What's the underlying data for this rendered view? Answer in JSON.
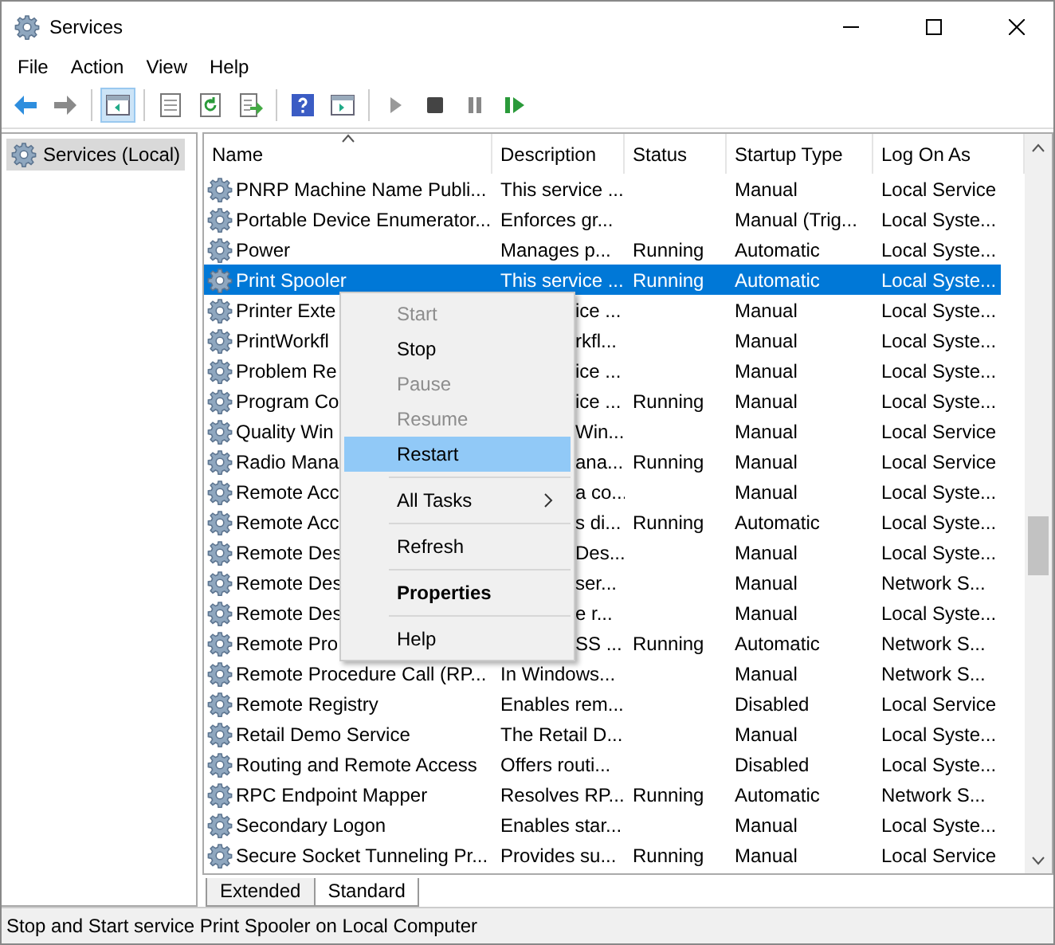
{
  "window": {
    "title": "Services"
  },
  "menu_bar": [
    "File",
    "Action",
    "View",
    "Help"
  ],
  "tree": {
    "items": [
      {
        "label": "Services (Local)",
        "selected": true
      }
    ]
  },
  "table": {
    "columns": [
      "Name",
      "Description",
      "Status",
      "Startup Type",
      "Log On As"
    ],
    "rows": [
      {
        "name": "PNRP Machine Name Publi...",
        "description": "This service ...",
        "status": "",
        "startup": "Manual",
        "logon": "Local Service",
        "selected": false,
        "partial": false
      },
      {
        "name": "Portable Device Enumerator...",
        "description": "Enforces gr...",
        "status": "",
        "startup": "Manual (Trig...",
        "logon": "Local Syste...",
        "selected": false,
        "partial": false
      },
      {
        "name": "Power",
        "description": "Manages p...",
        "status": "Running",
        "startup": "Automatic",
        "logon": "Local Syste...",
        "selected": false,
        "partial": false
      },
      {
        "name": "Print Spooler",
        "description": "This service ...",
        "status": "Running",
        "startup": "Automatic",
        "logon": "Local Syste...",
        "selected": true,
        "partial": false
      },
      {
        "name": "Printer Exte",
        "description": "ice ...",
        "status": "",
        "startup": "Manual",
        "logon": "Local Syste...",
        "selected": false,
        "partial": true
      },
      {
        "name": "PrintWorkfl",
        "description": "rkfl...",
        "status": "",
        "startup": "Manual",
        "logon": "Local Syste...",
        "selected": false,
        "partial": true
      },
      {
        "name": "Problem Re",
        "description": "ice ...",
        "status": "",
        "startup": "Manual",
        "logon": "Local Syste...",
        "selected": false,
        "partial": true
      },
      {
        "name": "Program Co",
        "description": "ice ...",
        "status": "Running",
        "startup": "Manual",
        "logon": "Local Syste...",
        "selected": false,
        "partial": true
      },
      {
        "name": "Quality Win",
        "description": "Win...",
        "status": "",
        "startup": "Manual",
        "logon": "Local Service",
        "selected": false,
        "partial": true
      },
      {
        "name": "Radio Mana",
        "description": "ana...",
        "status": "Running",
        "startup": "Manual",
        "logon": "Local Service",
        "selected": false,
        "partial": true
      },
      {
        "name": "Remote Acc",
        "description": "a co...",
        "status": "",
        "startup": "Manual",
        "logon": "Local Syste...",
        "selected": false,
        "partial": true
      },
      {
        "name": "Remote Acc",
        "description": "s di...",
        "status": "Running",
        "startup": "Automatic",
        "logon": "Local Syste...",
        "selected": false,
        "partial": true
      },
      {
        "name": "Remote Des",
        "description": "Des...",
        "status": "",
        "startup": "Manual",
        "logon": "Local Syste...",
        "selected": false,
        "partial": true
      },
      {
        "name": "Remote Des",
        "description": "ser...",
        "status": "",
        "startup": "Manual",
        "logon": "Network S...",
        "selected": false,
        "partial": true
      },
      {
        "name": "Remote Des",
        "description": "e r...",
        "status": "",
        "startup": "Manual",
        "logon": "Local Syste...",
        "selected": false,
        "partial": true
      },
      {
        "name": "Remote Pro",
        "description": "SS ...",
        "status": "Running",
        "startup": "Automatic",
        "logon": "Network S...",
        "selected": false,
        "partial": true
      },
      {
        "name": "Remote Procedure Call (RP...",
        "description": "In Windows...",
        "status": "",
        "startup": "Manual",
        "logon": "Network S...",
        "selected": false,
        "partial": false
      },
      {
        "name": "Remote Registry",
        "description": "Enables rem...",
        "status": "",
        "startup": "Disabled",
        "logon": "Local Service",
        "selected": false,
        "partial": false
      },
      {
        "name": "Retail Demo Service",
        "description": "The Retail D...",
        "status": "",
        "startup": "Manual",
        "logon": "Local Syste...",
        "selected": false,
        "partial": false
      },
      {
        "name": "Routing and Remote Access",
        "description": "Offers routi...",
        "status": "",
        "startup": "Disabled",
        "logon": "Local Syste...",
        "selected": false,
        "partial": false
      },
      {
        "name": "RPC Endpoint Mapper",
        "description": "Resolves RP...",
        "status": "Running",
        "startup": "Automatic",
        "logon": "Network S...",
        "selected": false,
        "partial": false
      },
      {
        "name": "Secondary Logon",
        "description": "Enables star...",
        "status": "",
        "startup": "Manual",
        "logon": "Local Syste...",
        "selected": false,
        "partial": false
      },
      {
        "name": "Secure Socket Tunneling Pr...",
        "description": "Provides su...",
        "status": "Running",
        "startup": "Manual",
        "logon": "Local Service",
        "selected": false,
        "partial": false
      }
    ]
  },
  "context_menu": [
    {
      "kind": "item",
      "label": "Start",
      "disabled": true,
      "selected": false
    },
    {
      "kind": "item",
      "label": "Stop",
      "disabled": false,
      "selected": false
    },
    {
      "kind": "item",
      "label": "Pause",
      "disabled": true,
      "selected": false
    },
    {
      "kind": "item",
      "label": "Resume",
      "disabled": true,
      "selected": false
    },
    {
      "kind": "item",
      "label": "Restart",
      "disabled": false,
      "selected": true
    },
    {
      "kind": "separator"
    },
    {
      "kind": "submenu",
      "label": "All Tasks",
      "disabled": false,
      "selected": false
    },
    {
      "kind": "separator"
    },
    {
      "kind": "item",
      "label": "Refresh",
      "disabled": false,
      "selected": false
    },
    {
      "kind": "separator"
    },
    {
      "kind": "default",
      "label": "Properties",
      "disabled": false,
      "selected": false
    },
    {
      "kind": "separator"
    },
    {
      "kind": "item",
      "label": "Help",
      "disabled": false,
      "selected": false
    }
  ],
  "view_tabs": [
    {
      "label": "Extended",
      "selected": false
    },
    {
      "label": "Standard",
      "selected": true
    }
  ],
  "status_bar": "Stop and Start service Print Spooler on Local Computer"
}
